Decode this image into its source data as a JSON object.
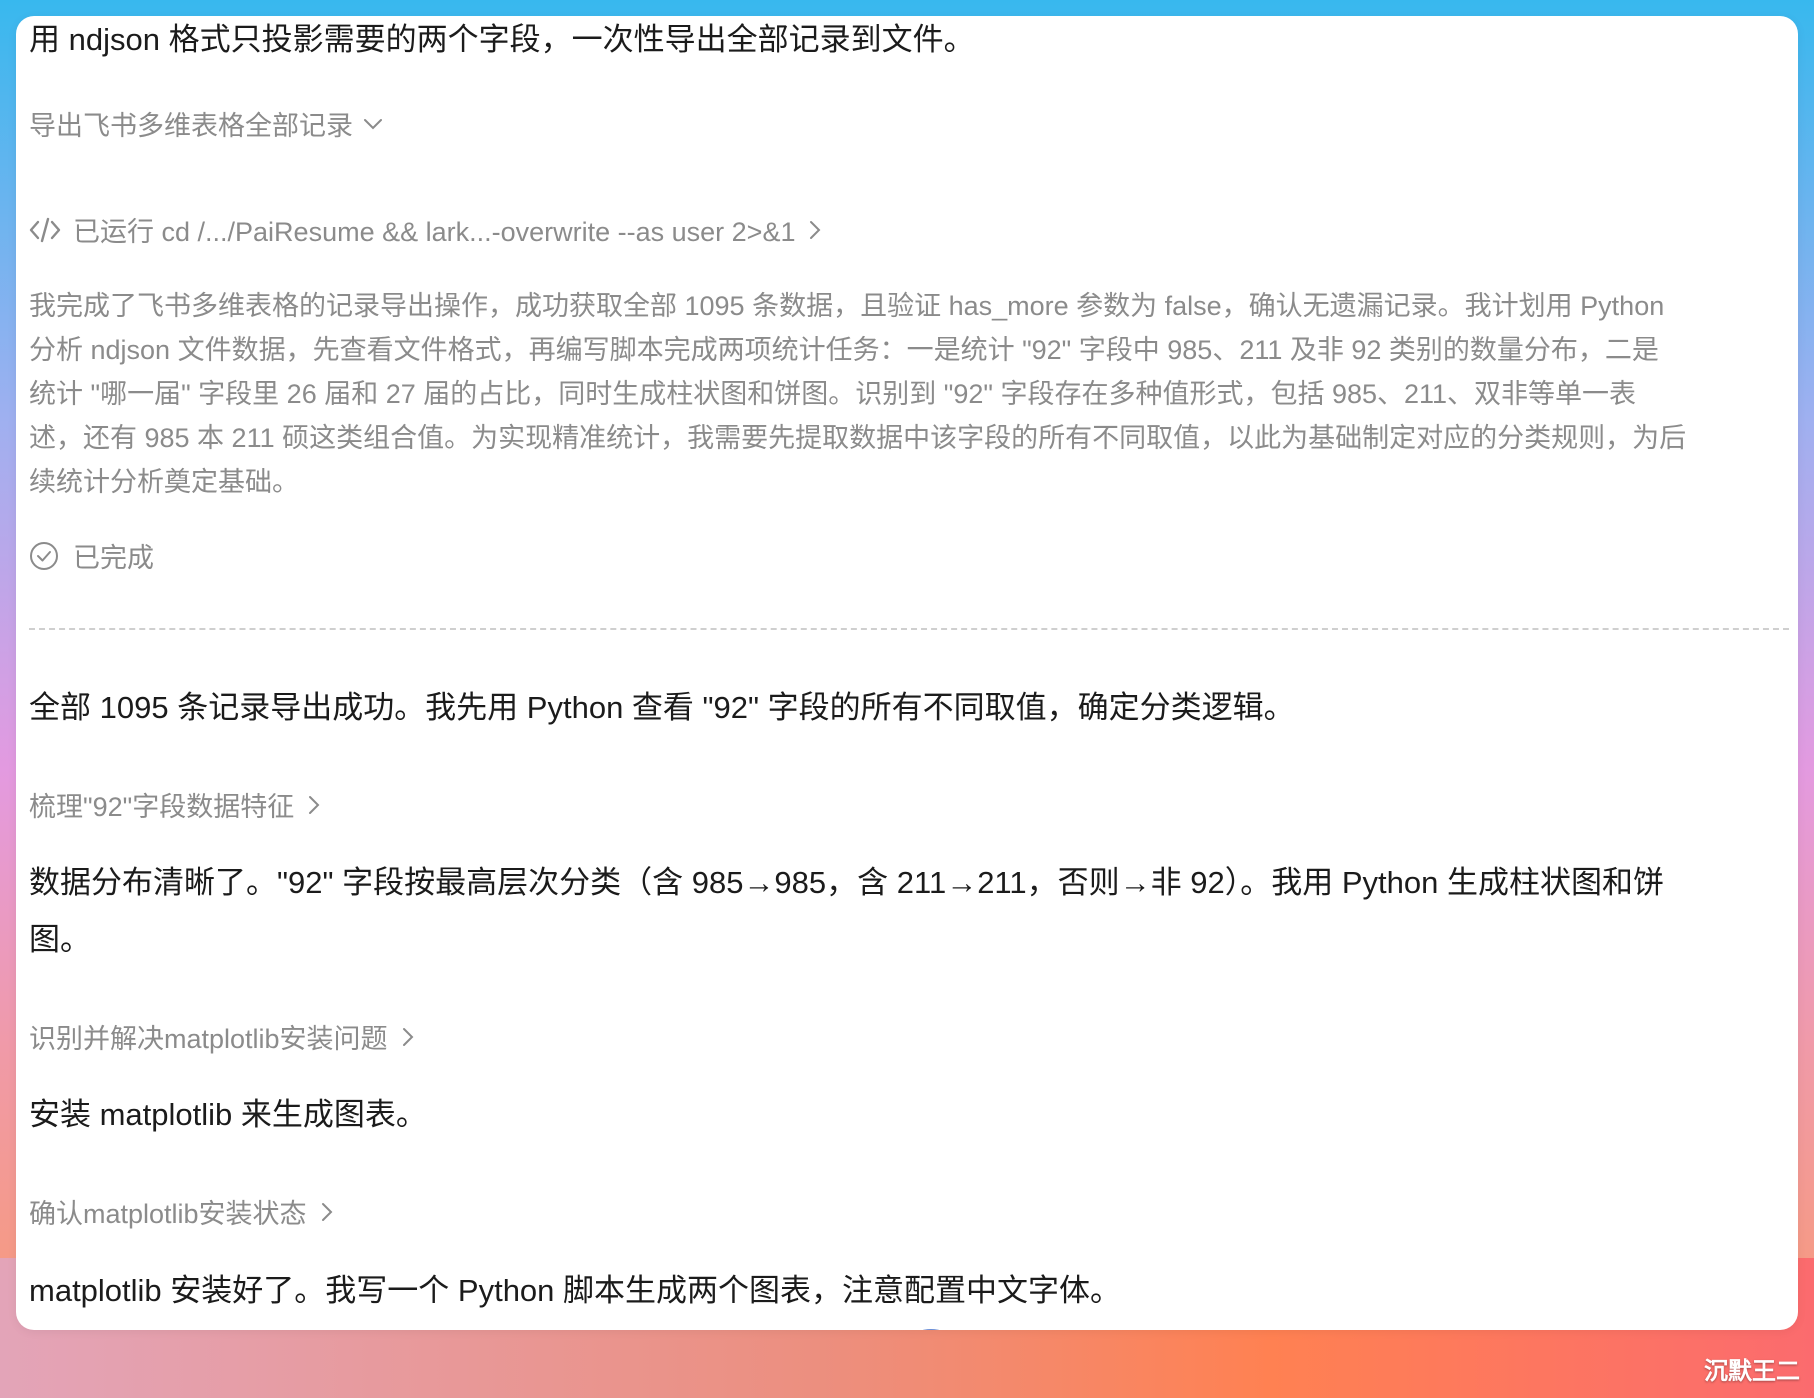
{
  "messages": {
    "intro": "用 ndjson 格式只投影需要的两个字段，一次性导出全部记录到文件。",
    "export_done": "全部 1095 条记录导出成功。我先用 Python 查看 \"92\" 字段的所有不同取值，确定分类逻辑。",
    "distribution_line1": "数据分布清晰了。\"92\" 字段按最高层次分类（含 985→985，含 211→211，否则→非 92）。我用 Python 生成柱状图和饼",
    "distribution_line2": "图。",
    "install_matplotlib": "安装 matplotlib 来生成图表。",
    "matplotlib_ready": "matplotlib 安装好了。我写一个 Python 脚本生成两个图表，注意配置中文字体。"
  },
  "sections": {
    "export_section": "导出飞书多维表格全部记录",
    "analyze_field": "梳理\"92\"字段数据特征",
    "fix_matplotlib": "识别并解决matplotlib安装问题",
    "confirm_install": "确认matplotlib安装状态"
  },
  "command": {
    "label": "已运行 cd /.../PaiResume && lark...-overwrite --as user 2>&1"
  },
  "reasoning": {
    "lines": [
      "我完成了飞书多维表格的记录导出操作，成功获取全部 1095 条数据，且验证 has_more 参数为 false，确认无遗漏记录。我计划用 Python",
      "分析 ndjson 文件数据，先查看文件格式，再编写脚本完成两项统计任务：一是统计 \"92\" 字段中 985、211 及非 92 类别的数量分布，二是",
      "统计 \"哪一届\" 字段里 26 届和 27 届的占比，同时生成柱状图和饼图。识别到 \"92\" 字段存在多种值形式，包括 985、211、双非等单一表",
      "述，还有 985 本 211 硕这类组合值。为实现精准统计，我需要先提取数据中该字段的所有不同取值，以此为基础制定对应的分类规则，为后",
      "续统计分析奠定基础。"
    ],
    "status": "已完成"
  },
  "watermark": "沉默王二",
  "colors": {
    "primary_text": "#1b1b1b",
    "muted_text": "#8b8b8b",
    "divider": "#cfcfcf",
    "spinner": "#6b8ed6"
  },
  "icons": {
    "code": "code-icon",
    "check": "check-circle-icon",
    "expand": "chevron-down-icon",
    "collapsed": "chevron-right-icon"
  }
}
